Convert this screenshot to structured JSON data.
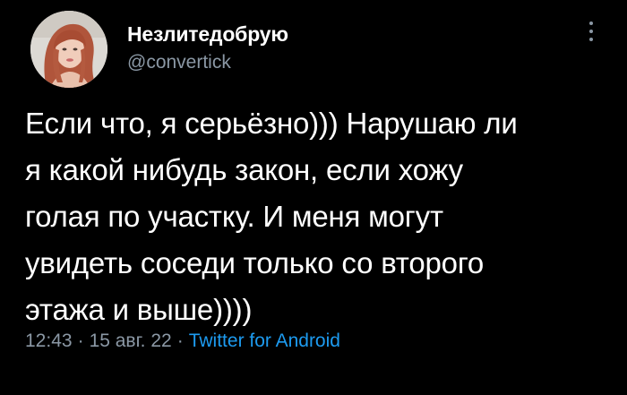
{
  "user": {
    "display_name": "Незлитедобрую",
    "handle": "@convertick"
  },
  "tweet": {
    "text": "Если что, я серьёзно))) Нарушаю ли\nя какой нибудь закон, если хожу\nголая по участку. И меня могут\nувидеть соседи только со второго\nэтажа и выше))))",
    "time": "12:43",
    "separator": "·",
    "date": "15 авг. 22",
    "source": "Twitter for Android"
  },
  "icons": {
    "more": "more-vertical-icon"
  },
  "colors": {
    "background": "#000000",
    "text_primary": "#ffffff",
    "text_secondary": "#8b98a5",
    "link": "#1d9bf0"
  }
}
